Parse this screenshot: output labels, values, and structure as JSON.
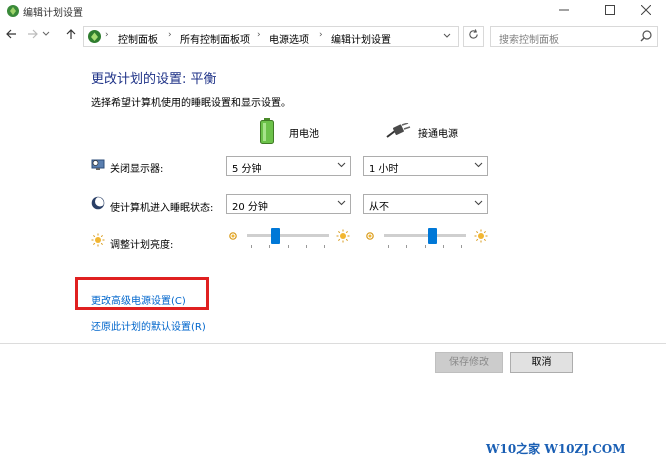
{
  "window": {
    "title": "编辑计划设置",
    "minimize_icon": "minimize-icon",
    "maximize_icon": "maximize-icon",
    "close_icon": "close-icon"
  },
  "address_bar": {
    "breadcrumbs": [
      "控制面板",
      "所有控制面板项",
      "电源选项",
      "编辑计划设置"
    ],
    "search_placeholder": "搜索控制面板"
  },
  "main": {
    "title": "更改计划的设置: 平衡",
    "description": "选择希望计算机使用的睡眠设置和显示设置。",
    "columns": {
      "battery": "用电池",
      "plugged_in": "接通电源"
    },
    "settings": {
      "display_off": {
        "label": "关闭显示器:",
        "battery_value": "5 分钟",
        "plugged_value": "1 小时"
      },
      "sleep": {
        "label": "使计算机进入睡眠状态:",
        "battery_value": "20 分钟",
        "plugged_value": "从不"
      },
      "brightness": {
        "label": "调整计划亮度:",
        "battery_level": 0.33,
        "plugged_level": 0.6
      }
    },
    "links": {
      "advanced": "更改高级电源设置(C)",
      "restore": "还原此计划的默认设置(R)"
    }
  },
  "buttons": {
    "save": "保存修改",
    "cancel": "取消"
  },
  "watermark": "W10之家 W10ZJ.COM",
  "colors": {
    "title": "#1e3287",
    "link": "#0066cc",
    "slider_thumb": "#0078d7",
    "highlight_border": "#e02020"
  }
}
